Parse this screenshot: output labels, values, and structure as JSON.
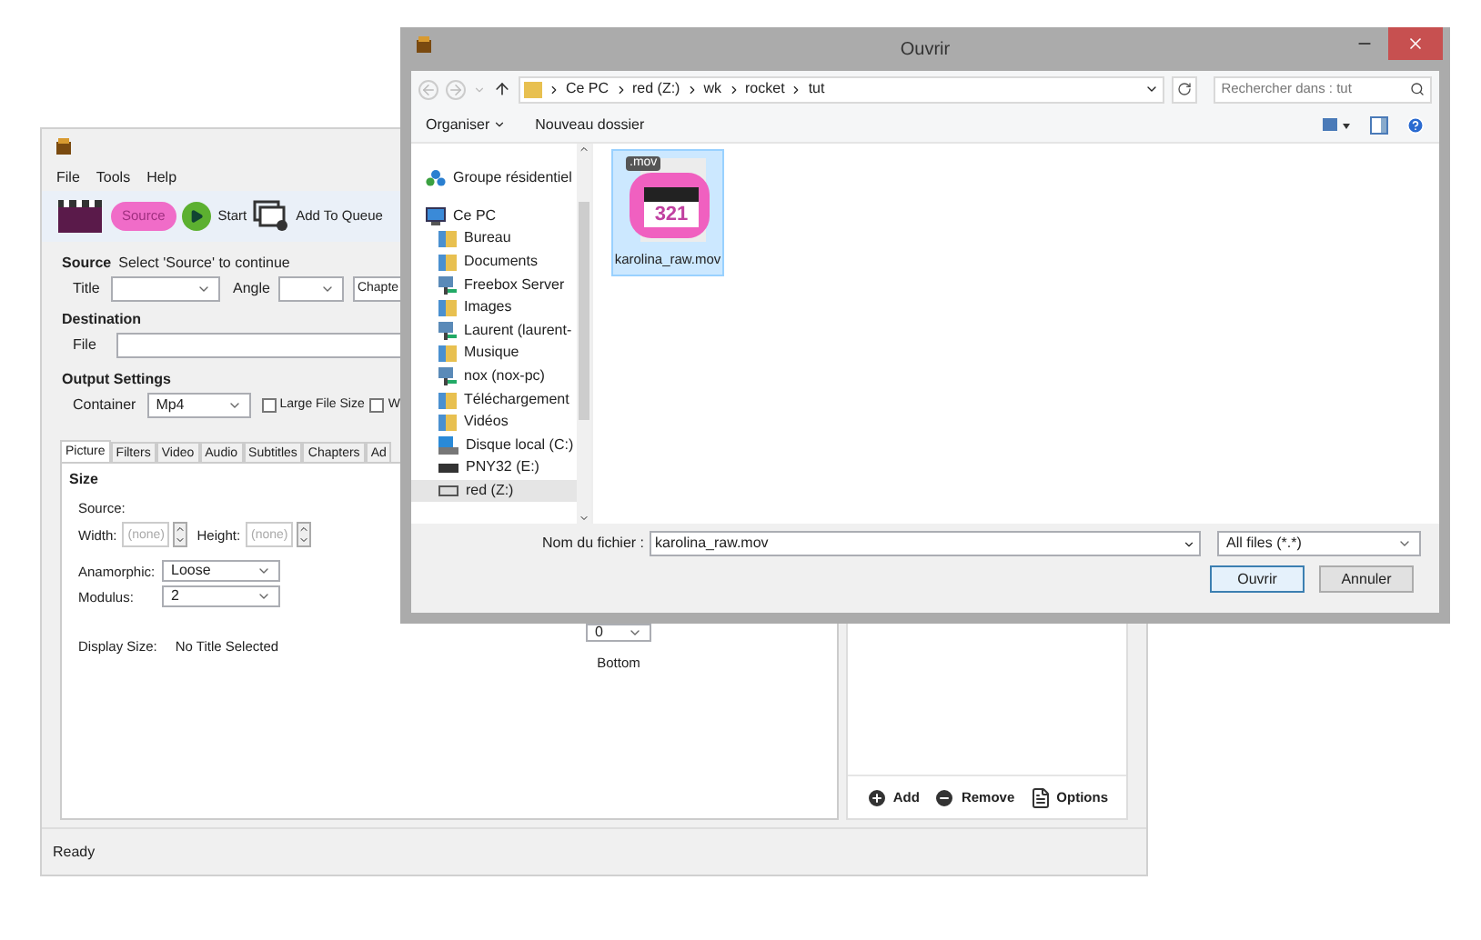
{
  "main_window": {
    "menu": [
      "File",
      "Tools",
      "Help"
    ],
    "toolbar": [
      {
        "label": "Source",
        "kind": "source",
        "highlighted": true
      },
      {
        "label": "Start",
        "kind": "start",
        "highlighted": false
      },
      {
        "label": "Add To Queue",
        "kind": "queue",
        "highlighted": false
      }
    ],
    "source": {
      "label": "Source",
      "hint": "Select 'Source' to continue"
    },
    "title_row": {
      "title_label": "Title",
      "angle_label": "Angle",
      "chapters_label": "Chapte"
    },
    "destination": {
      "label": "Destination",
      "file_label": "File"
    },
    "output": {
      "label": "Output Settings",
      "container_label": "Container",
      "container_value": "Mp4",
      "checkboxes": [
        {
          "label": "Large File Size",
          "checked": false
        },
        {
          "label": "W",
          "checked": false
        }
      ]
    },
    "tabs": [
      {
        "label": "Picture",
        "selected": true
      },
      {
        "label": "Filters",
        "selected": false
      },
      {
        "label": "Video",
        "selected": false
      },
      {
        "label": "Audio",
        "selected": false
      },
      {
        "label": "Subtitles",
        "selected": false
      },
      {
        "label": "Chapters",
        "selected": false
      },
      {
        "label": "Ad",
        "selected": false
      }
    ],
    "picture": {
      "size_label": "Size",
      "source_label": "Source:",
      "width_label": "Width:",
      "width_placeholder": "(none)",
      "height_label": "Height:",
      "height_placeholder": "(none)",
      "anamorphic_label": "Anamorphic:",
      "anamorphic_value": "Loose",
      "modulus_label": "Modulus:",
      "modulus_value": "2",
      "display_label": "Display Size:",
      "display_value": "No Title Selected",
      "crop_value": "0",
      "crop_label": "Bottom"
    },
    "queue_actions": [
      {
        "label": "Add",
        "kind": "add"
      },
      {
        "label": "Remove",
        "kind": "remove"
      },
      {
        "label": "Options",
        "kind": "options"
      }
    ],
    "status_bar": "Ready"
  },
  "dialog": {
    "title": "Ouvrir",
    "breadcrumbs": [
      "Ce PC",
      "red (Z:)",
      "wk",
      "rocket",
      "tut"
    ],
    "search": {
      "placeholder": "Rechercher dans : tut"
    },
    "toolbar": {
      "organize": "Organiser",
      "new_folder": "Nouveau dossier"
    },
    "nav": [
      {
        "label": "Groupe résidentiel",
        "kind": "homegroup",
        "selected": false
      },
      {
        "label": "Ce PC",
        "kind": "pc",
        "selected": false,
        "children": [
          {
            "label": "Bureau",
            "kind": "folder",
            "selected": false
          },
          {
            "label": "Documents",
            "kind": "folder",
            "selected": false
          },
          {
            "label": "Freebox Server",
            "kind": "network",
            "selected": false
          },
          {
            "label": "Images",
            "kind": "folder",
            "selected": false
          },
          {
            "label": "Laurent (laurent-",
            "kind": "network",
            "selected": false
          },
          {
            "label": "Musique",
            "kind": "folder",
            "selected": false
          },
          {
            "label": "nox (nox-pc)",
            "kind": "network",
            "selected": false
          },
          {
            "label": "Téléchargement",
            "kind": "folder",
            "selected": false
          },
          {
            "label": "Vidéos",
            "kind": "folder",
            "selected": false
          },
          {
            "label": "Disque local (C:)",
            "kind": "disk",
            "selected": false
          },
          {
            "label": "PNY32 (E:)",
            "kind": "usb",
            "selected": false
          },
          {
            "label": "red (Z:)",
            "kind": "netdrive",
            "selected": true
          }
        ]
      }
    ],
    "files": [
      {
        "name": "karolina_raw.mov",
        "badge": ".mov",
        "digits": "321",
        "selected": true
      }
    ],
    "filename_label": "Nom du fichier :",
    "filename_value": "karolina_raw.mov",
    "filter": "All files (*.*)",
    "buttons": [
      {
        "label": "Ouvrir",
        "kind": "primary"
      },
      {
        "label": "Annuler",
        "kind": "secondary"
      }
    ]
  }
}
